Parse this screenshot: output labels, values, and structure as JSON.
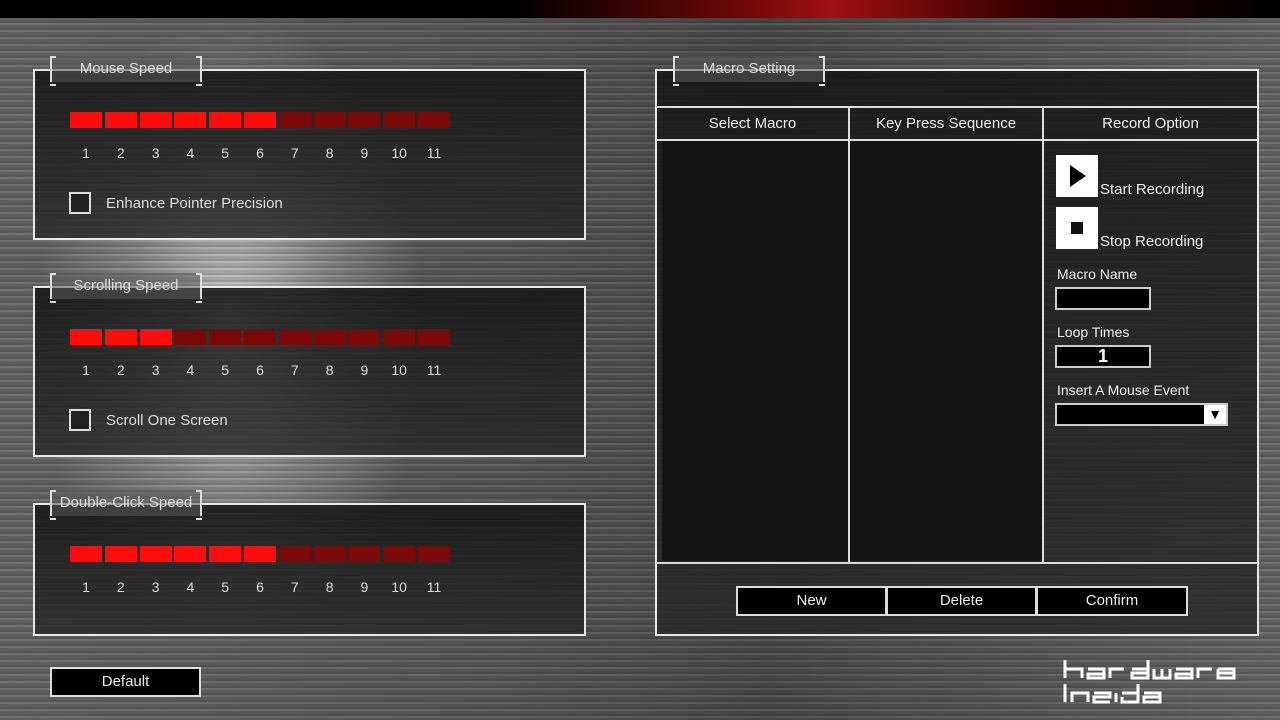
{
  "colors": {
    "active_segment": "#ff0c0c",
    "inactive_segment": "#7a0a08"
  },
  "speed_panels": [
    {
      "title": "Mouse Speed",
      "level": 6,
      "max": 11,
      "checkbox_label": "Enhance Pointer Precision",
      "checked": false
    },
    {
      "title": "Scrolling Speed",
      "level": 3,
      "max": 11,
      "checkbox_label": "Scroll One Screen",
      "checked": false
    },
    {
      "title": "Double-Click Speed",
      "level": 6,
      "max": 11
    }
  ],
  "scale_labels": [
    "1",
    "2",
    "3",
    "4",
    "5",
    "6",
    "7",
    "8",
    "9",
    "10",
    "11"
  ],
  "default_button": "Default",
  "macro": {
    "title": "Macro Setting",
    "columns": [
      "Select Macro",
      "Key Press Sequence",
      "Record Option"
    ],
    "start_recording": "Start Recording",
    "stop_recording": "Stop Recording",
    "macro_name_label": "Macro Name",
    "macro_name_value": "",
    "loop_times_label": "Loop Times",
    "loop_times_value": "1",
    "mouse_event_label": "Insert A Mouse Event",
    "mouse_event_value": "",
    "buttons": [
      "New",
      "Delete",
      "Confirm"
    ]
  },
  "logo": "hardware inside"
}
